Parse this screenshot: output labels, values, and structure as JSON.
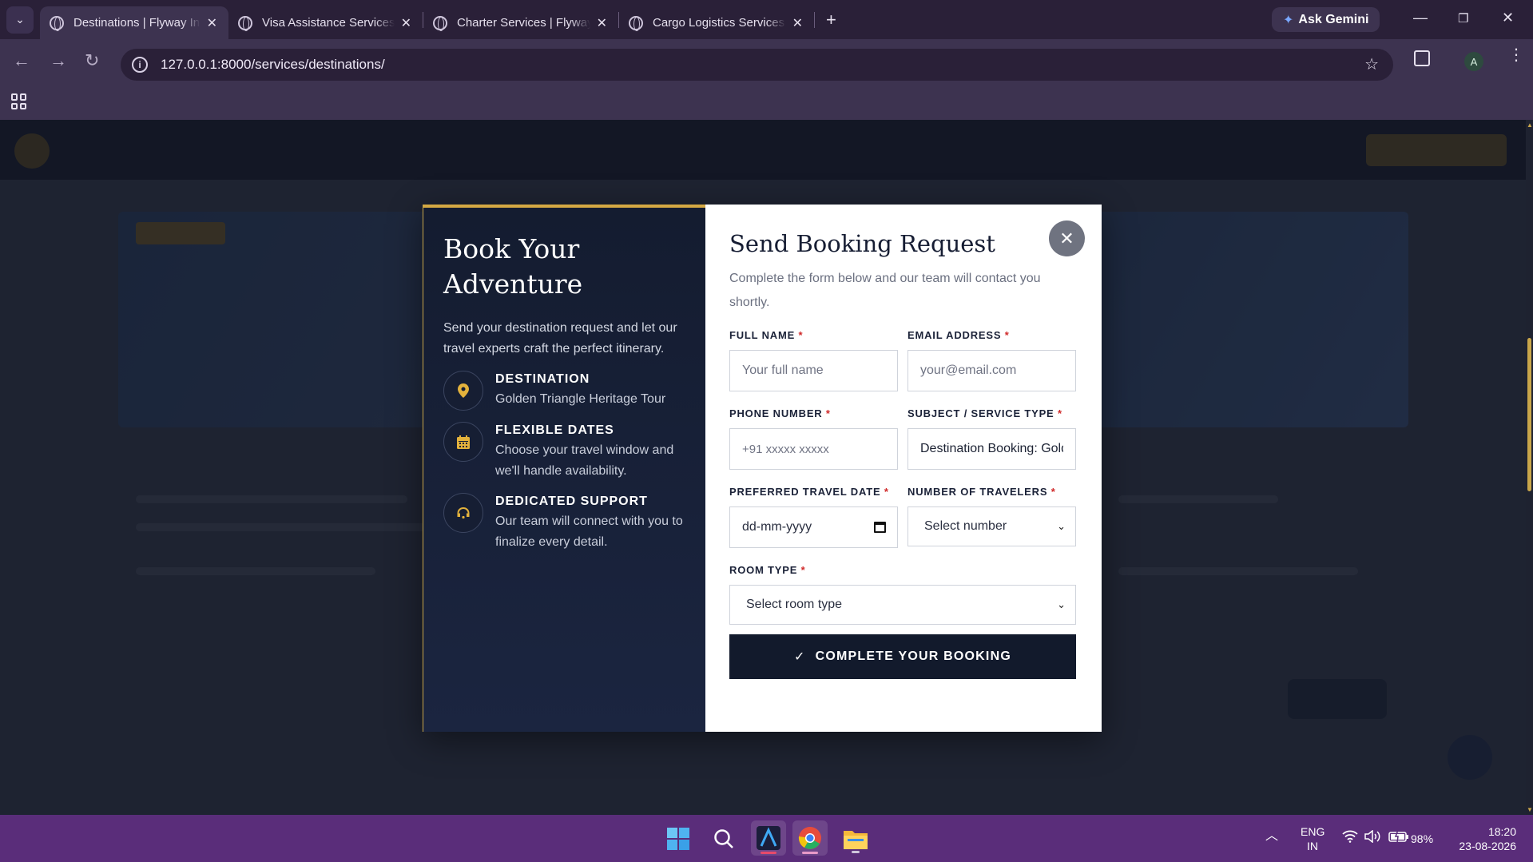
{
  "browser": {
    "tabs": [
      {
        "title": "Destinations | Flyway India Pvt Ltd",
        "active": true
      },
      {
        "title": "Visa Assistance Services | Flyway India",
        "active": false
      },
      {
        "title": "Charter Services | Flyway India Pvt Ltd",
        "active": false
      },
      {
        "title": "Cargo Logistics Services | Flyway India",
        "active": false
      }
    ],
    "ask_gemini": "Ask Gemini",
    "url": "127.0.0.1:8000/services/destinations/",
    "profile_initial": "A"
  },
  "modal": {
    "left": {
      "title": "Book Your Adventure",
      "subtitle": "Send your destination request and let our travel experts craft the perfect itinerary.",
      "features": [
        {
          "icon": "location-pin-icon",
          "title": "DESTINATION",
          "desc": "Golden Triangle Heritage Tour"
        },
        {
          "icon": "calendar-icon",
          "title": "FLEXIBLE DATES",
          "desc": "Choose your travel window and we'll handle availability."
        },
        {
          "icon": "headset-icon",
          "title": "DEDICATED SUPPORT",
          "desc": "Our team will connect with you to finalize every detail."
        }
      ]
    },
    "right": {
      "title": "Send Booking Request",
      "subtitle": "Complete the form below and our team will contact you shortly.",
      "fields": {
        "full_name": {
          "label": "FULL NAME",
          "placeholder": "Your full name",
          "value": ""
        },
        "email": {
          "label": "EMAIL ADDRESS",
          "placeholder": "your@email.com",
          "value": ""
        },
        "phone": {
          "label": "PHONE NUMBER",
          "placeholder": "+91 xxxxx xxxxx",
          "value": ""
        },
        "subject": {
          "label": "SUBJECT / SERVICE TYPE",
          "placeholder": "",
          "value": "Destination Booking: Golden Triangle Heritage Tour"
        },
        "travel_date": {
          "label": "PREFERRED TRAVEL DATE",
          "value": "dd-mm-yyyy"
        },
        "travelers": {
          "label": "NUMBER OF TRAVELERS",
          "value": "Select number"
        },
        "room_type": {
          "label": "ROOM TYPE",
          "value": "Select room type"
        }
      },
      "required_mark": "*",
      "submit_label": "COMPLETE YOUR BOOKING",
      "close_symbol": "✕"
    },
    "accent_color": "#d4a843"
  },
  "taskbar": {
    "language": "ENG",
    "region": "IN",
    "battery": "98%",
    "time": "18:20",
    "date": "23-08-2026"
  }
}
